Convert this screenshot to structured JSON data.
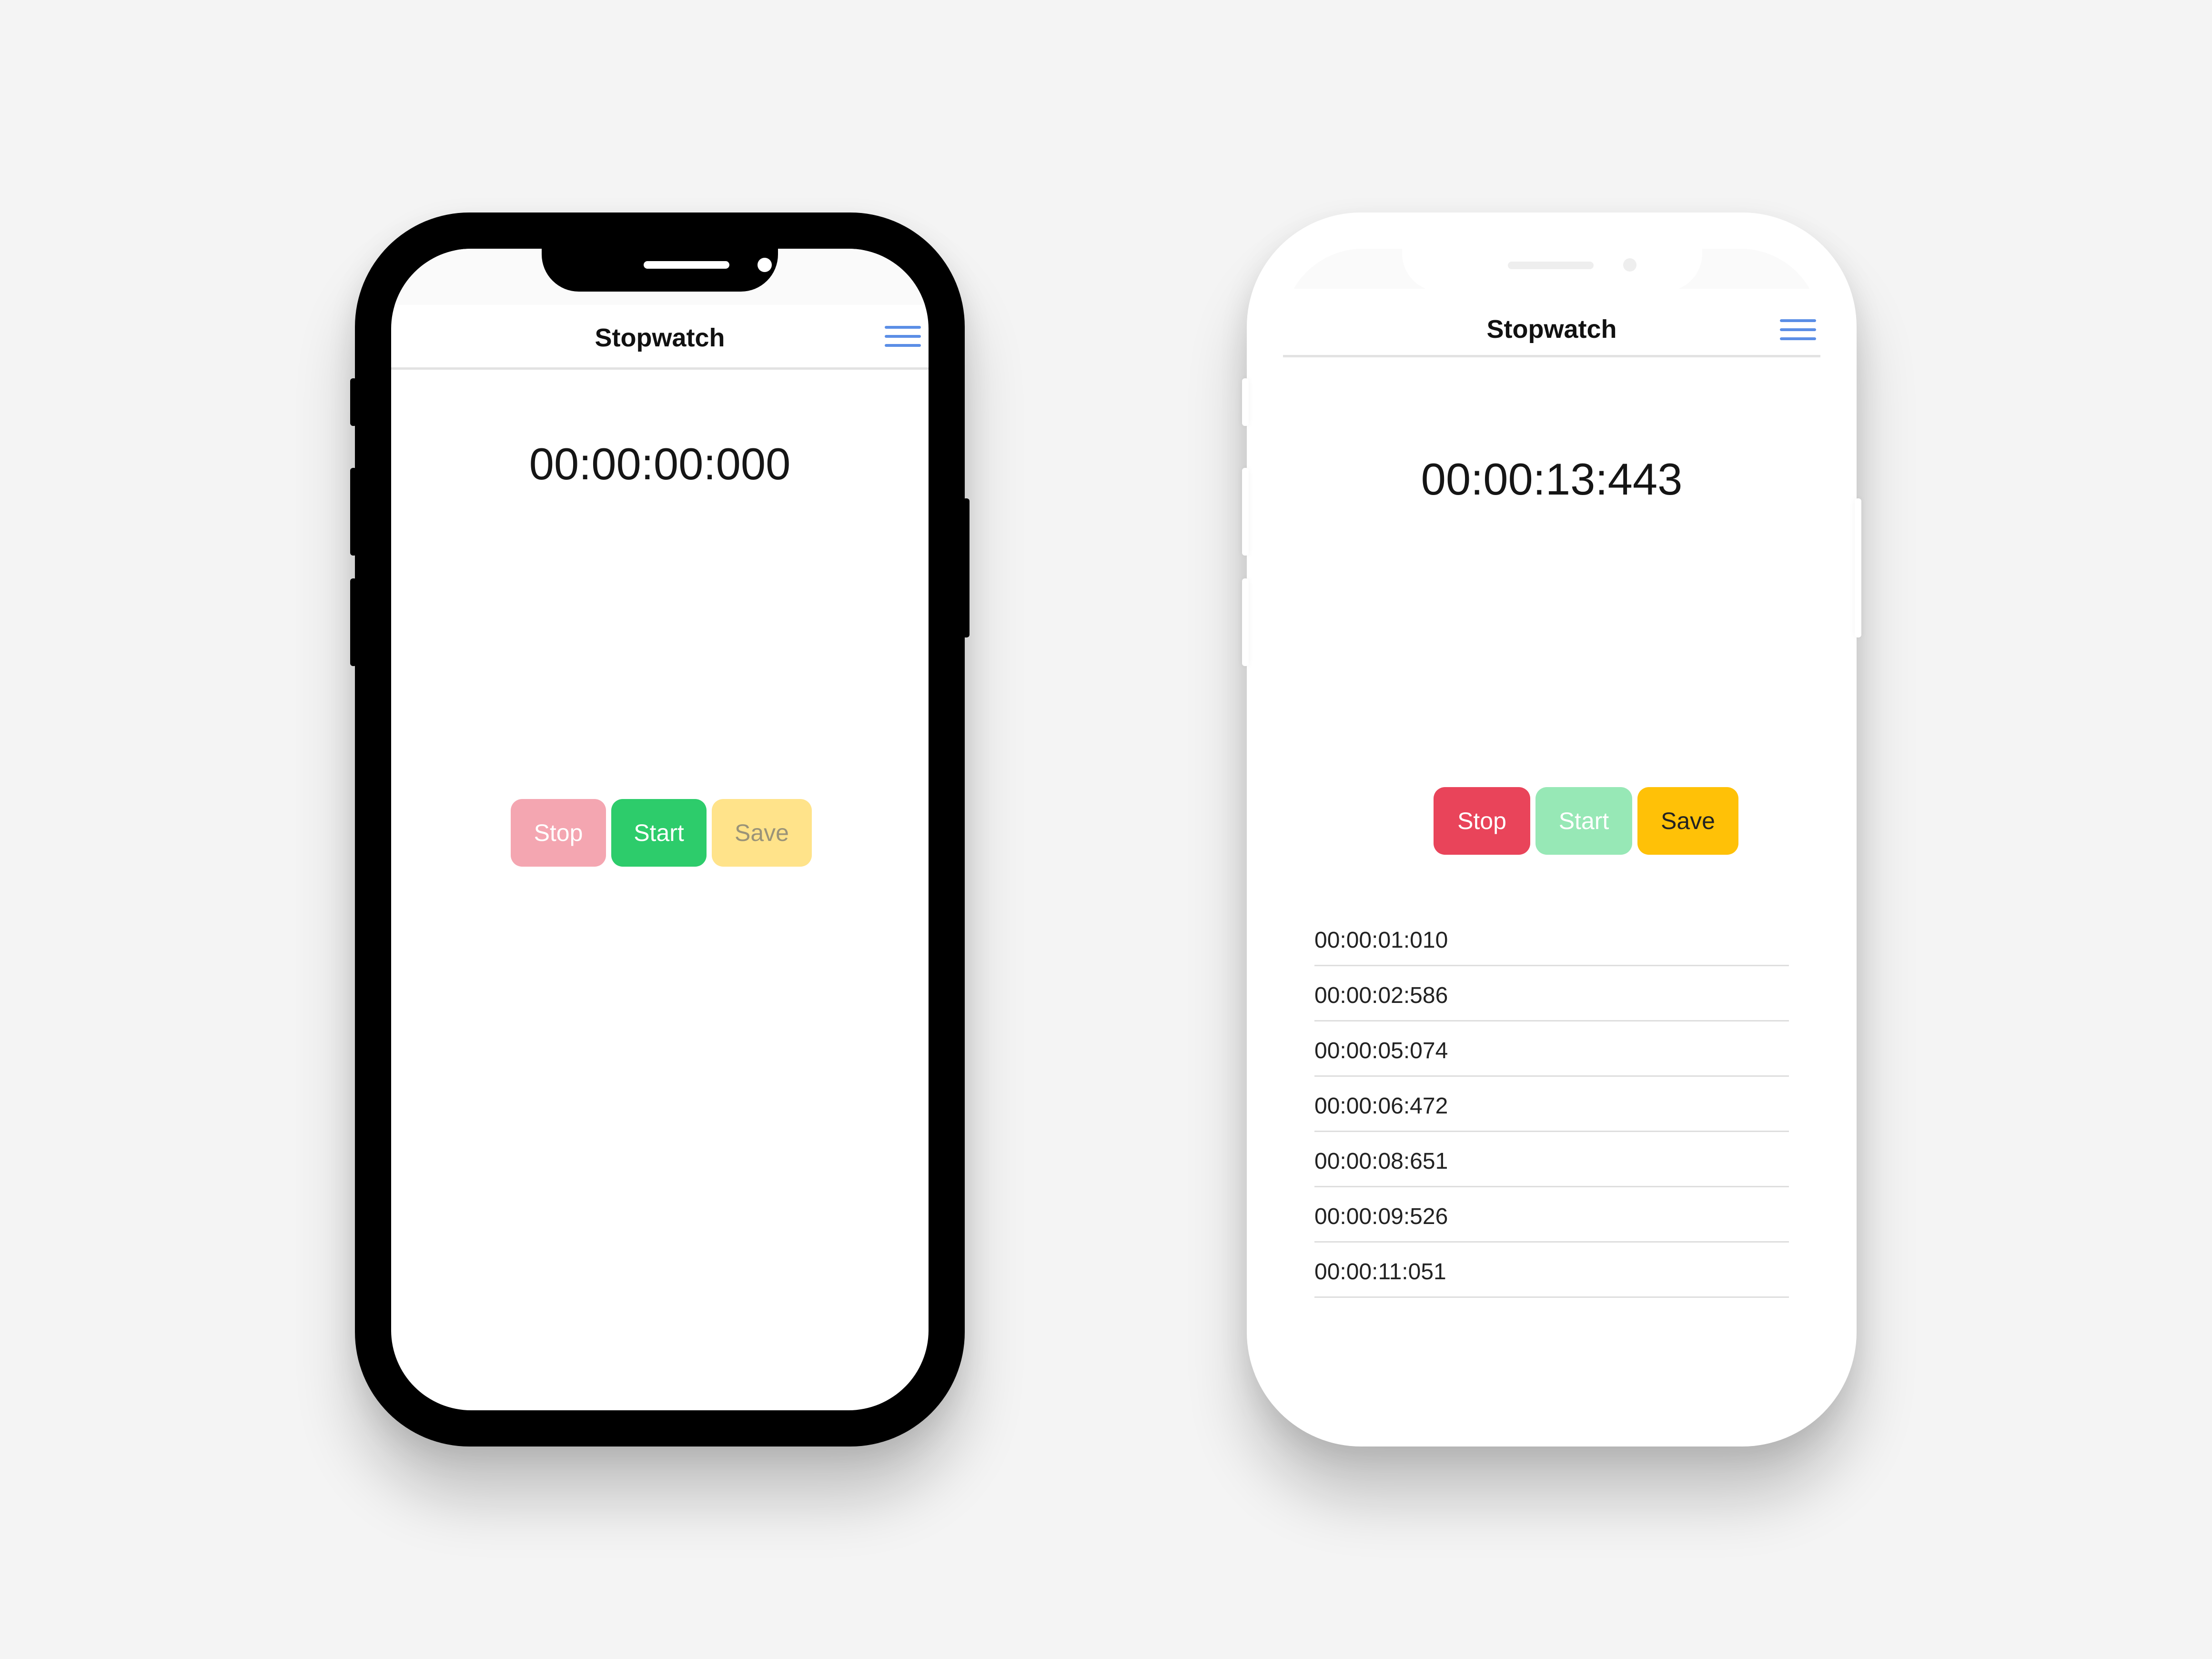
{
  "colors": {
    "background": "#f4f4f4",
    "menu_icon": "#5b8ee6",
    "stop_enabled": "#e9445a",
    "stop_disabled": "#f4a6b1",
    "start_enabled": "#2dcc6b",
    "start_disabled": "#97e8b6",
    "save_enabled": "#ffc107",
    "save_disabled": "#ffe38a"
  },
  "phones": {
    "left": {
      "header": {
        "title": "Stopwatch",
        "menu_icon": "hamburger-menu-icon"
      },
      "timer": "00:00:00:000",
      "buttons": {
        "stop": "Stop",
        "start": "Start",
        "save": "Save"
      },
      "laps": []
    },
    "right": {
      "header": {
        "title": "Stopwatch",
        "menu_icon": "hamburger-menu-icon"
      },
      "timer": "00:00:13:443",
      "buttons": {
        "stop": "Stop",
        "start": "Start",
        "save": "Save"
      },
      "laps": [
        "00:00:01:010",
        "00:00:02:586",
        "00:00:05:074",
        "00:00:06:472",
        "00:00:08:651",
        "00:00:09:526",
        "00:00:11:051"
      ]
    }
  }
}
